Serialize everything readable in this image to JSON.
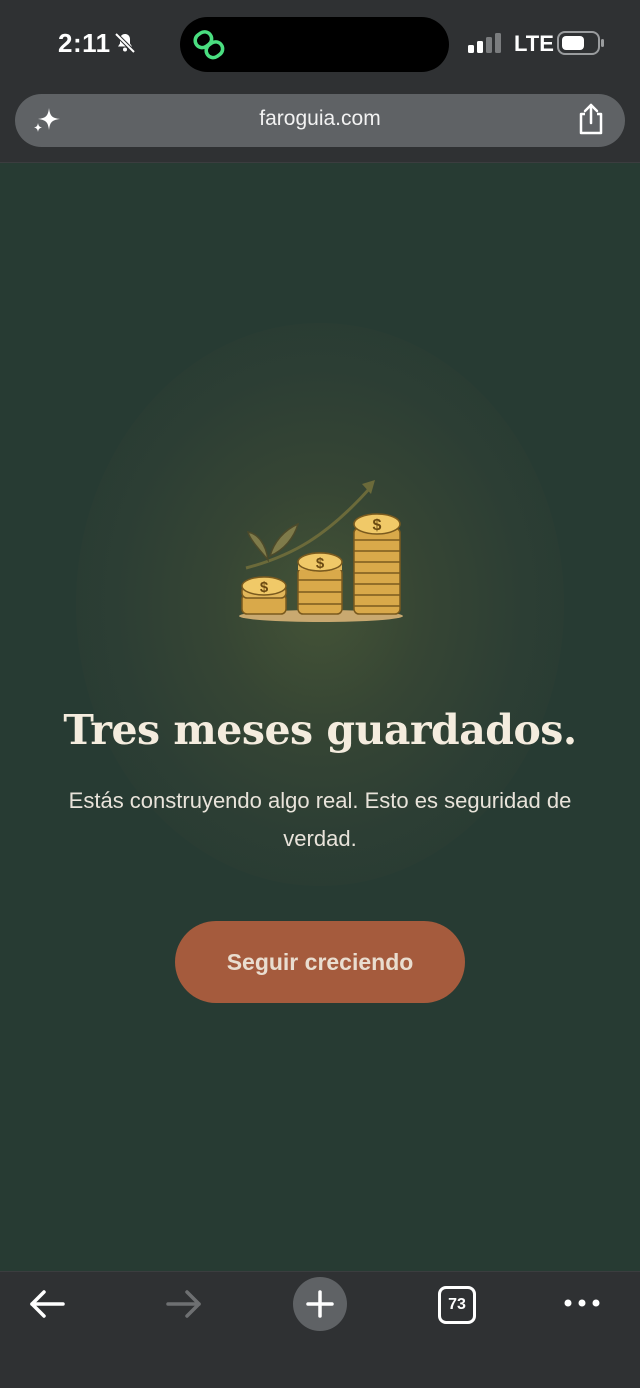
{
  "status_bar": {
    "time": "2:11",
    "network": "LTE"
  },
  "browser": {
    "url": "faroguia.com",
    "tab_count": "73"
  },
  "content": {
    "headline": "Tres meses guardados.",
    "subtext": "Estás construyendo algo real. Esto es seguridad de verdad.",
    "cta_label": "Seguir creciendo"
  },
  "icons": {
    "status": [
      "bell-slash-icon",
      "link-icon",
      "signal-icon",
      "battery-icon"
    ],
    "browser": [
      "sparkle-icon",
      "share-icon"
    ],
    "toolbar": [
      "back-arrow-icon",
      "forward-arrow-icon",
      "plus-icon",
      "tabs-icon",
      "more-icon"
    ],
    "illustration": "coin-stacks-growth-icon"
  },
  "colors": {
    "background": "#273b33",
    "browser_chrome": "#2f3133",
    "cta": "#a55b3d",
    "headline": "#f4ecde",
    "coin": "#e2b75a",
    "island_link": "#4ade80"
  }
}
